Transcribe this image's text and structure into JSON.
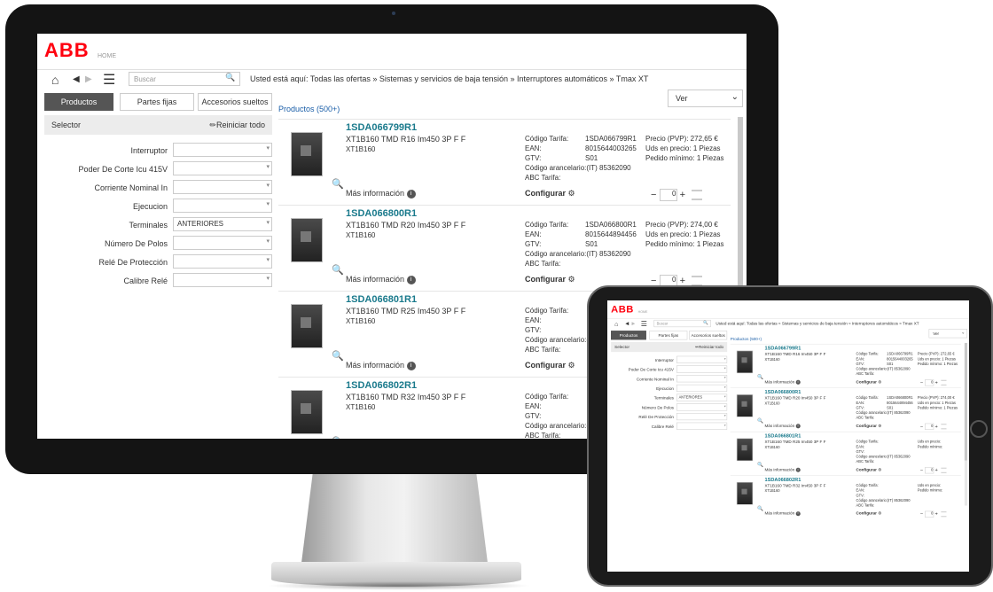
{
  "logo": "ABB",
  "home_label": "HOME",
  "search": {
    "placeholder": "Buscar"
  },
  "breadcrumb": "Usted está aquí: Todas las ofertas » Sistemas y servicios de baja tensión » Interruptores automáticos » Tmax XT",
  "tabs": [
    "Productos",
    "Partes fijas",
    "Accesorios sueltos"
  ],
  "selector": {
    "title": "Selector",
    "reset": "Reiniciar todo"
  },
  "filters": [
    {
      "label": "Interruptor",
      "value": ""
    },
    {
      "label": "Poder De Corte Icu 415V",
      "value": ""
    },
    {
      "label": "Corriente Nominal In",
      "value": ""
    },
    {
      "label": "Ejecucion",
      "value": ""
    },
    {
      "label": "Terminales",
      "value": "ANTERIORES"
    },
    {
      "label": "Número De Polos",
      "value": ""
    },
    {
      "label": "Relé De Protección",
      "value": ""
    },
    {
      "label": "Calibre Relé",
      "value": ""
    }
  ],
  "products_count": "Productos (500+)",
  "view_select": "Ver",
  "labels": {
    "more_info": "Más información",
    "configure": "Configurar",
    "codigo_tarifa": "Código Tarifa:",
    "ean": "EAN:",
    "gtv": "GTV:",
    "codigo_arancelario": "Código arancelario:(IT) 85362090",
    "abc_tarifa": "ABC Tarifa:",
    "uds_precio": "Uds en precio:",
    "pedido_minimo": "Pedido mínimo:",
    "qty": "0"
  },
  "products": [
    {
      "id": "1SDA066799R1",
      "desc": "XT1B160 TMD R16 Im450 3P F F",
      "family": "XT1B160",
      "codigo": "1SDA066799R1",
      "ean": "8015644003265",
      "gtv": "S01",
      "precio": "Precio (PVP):  272,65 €",
      "uds": "1 Piezas",
      "pedido": "1 Piezas"
    },
    {
      "id": "1SDA066800R1",
      "desc": "XT1B160 TMD R20 Im450 3P F F",
      "family": "XT1B160",
      "codigo": "1SDA066800R1",
      "ean": "8015644894456",
      "gtv": "S01",
      "precio": "Precio (PVP):  274,00 €",
      "uds": "1 Piezas",
      "pedido": "1 Piezas"
    },
    {
      "id": "1SDA066801R1",
      "desc": "XT1B160 TMD R25 Im450 3P F F",
      "family": "XT1B160",
      "codigo": "",
      "ean": "",
      "gtv": "",
      "precio": "",
      "uds": "",
      "pedido": ""
    },
    {
      "id": "1SDA066802R1",
      "desc": "XT1B160 TMD R32 Im450 3P F F",
      "family": "XT1B160",
      "codigo": "",
      "ean": "",
      "gtv": "",
      "precio": "",
      "uds": "",
      "pedido": ""
    }
  ]
}
